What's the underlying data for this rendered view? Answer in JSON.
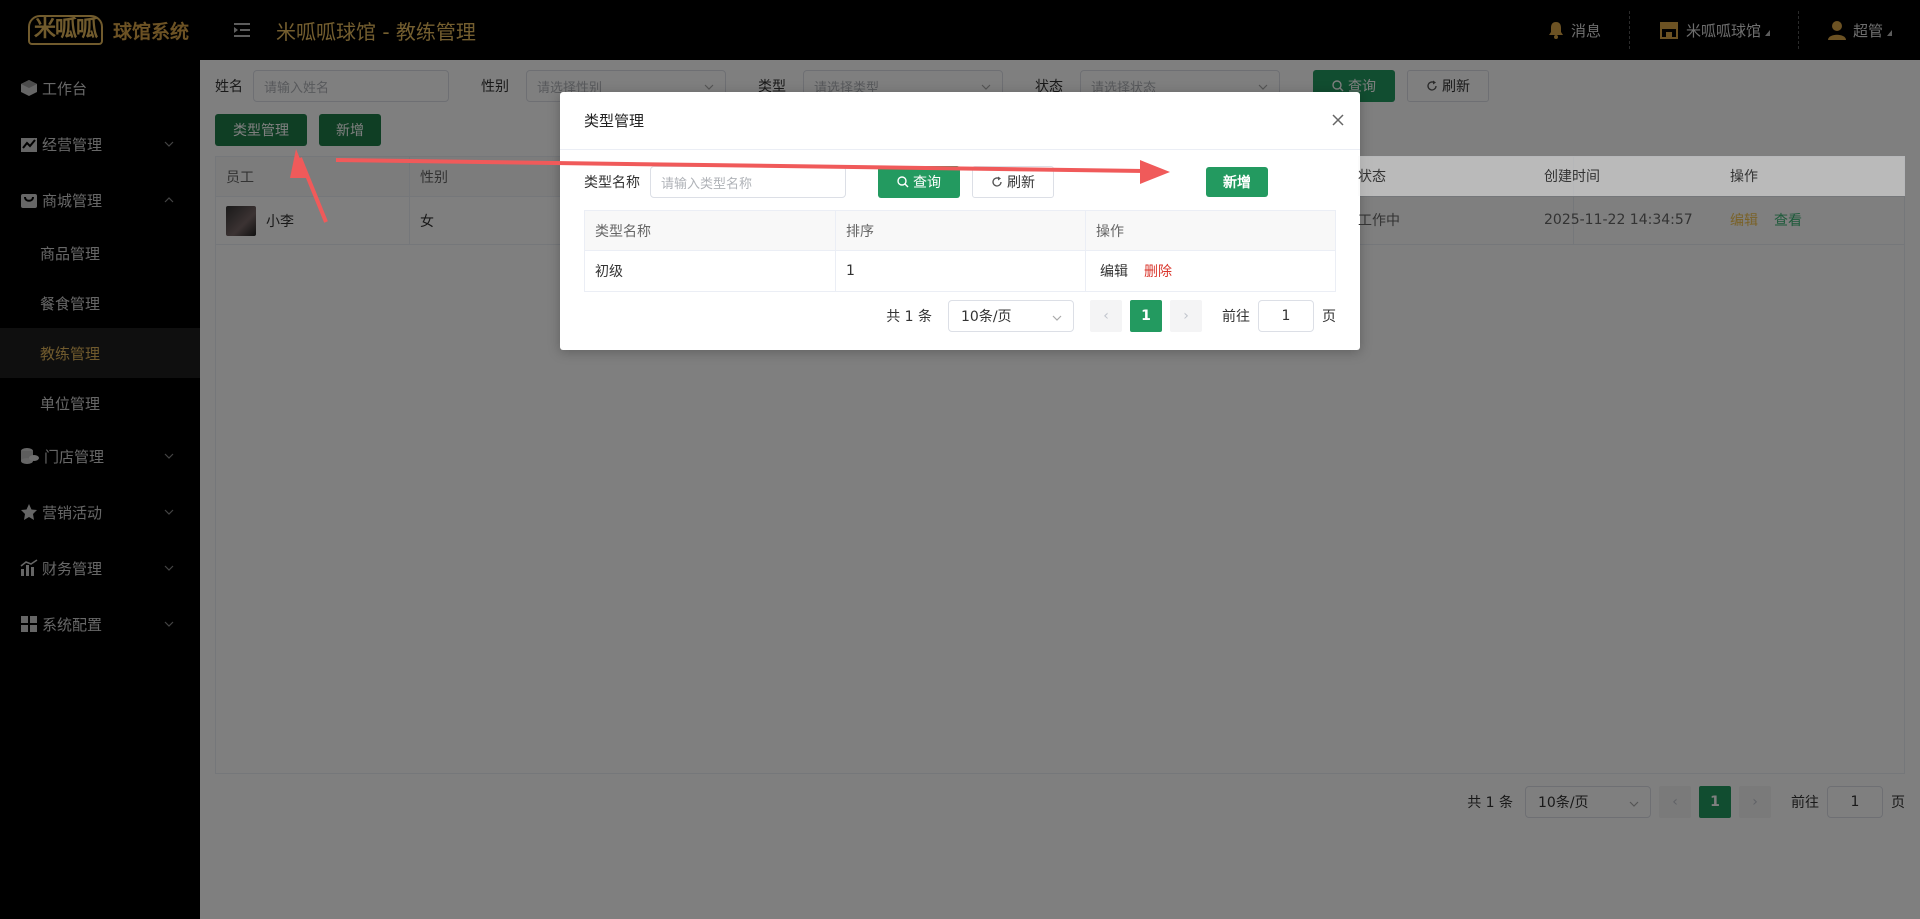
{
  "header": {
    "logo_mark": "米呱呱",
    "logo_text": "球馆系统",
    "title": "米呱呱球馆 - 教练管理",
    "messages_label": "消息",
    "store_label": "米呱呱球馆",
    "user_label": "超管"
  },
  "sidebar": {
    "items": [
      {
        "label": "工作台",
        "icon": "cube-icon"
      },
      {
        "label": "经营管理",
        "icon": "chart-icon"
      },
      {
        "label": "商城管理",
        "icon": "bag-icon"
      },
      {
        "label": "商品管理"
      },
      {
        "label": "餐食管理"
      },
      {
        "label": "教练管理"
      },
      {
        "label": "单位管理"
      },
      {
        "label": "门店管理",
        "icon": "coins-icon"
      },
      {
        "label": "营销活动",
        "icon": "star-icon"
      },
      {
        "label": "财务管理",
        "icon": "bars-icon"
      },
      {
        "label": "系统配置",
        "icon": "grid-icon"
      }
    ]
  },
  "filters": {
    "name_label": "姓名",
    "name_placeholder": "请输入姓名",
    "gender_label": "性别",
    "gender_placeholder": "请选择性别",
    "type_label": "类型",
    "type_placeholder": "请选择类型",
    "status_label": "状态",
    "status_placeholder": "请选择状态",
    "query_label": "查询",
    "refresh_label": "刷新"
  },
  "actions": {
    "type_manage_label": "类型管理",
    "add_label": "新增"
  },
  "table": {
    "columns": [
      "员工",
      "性别",
      "状态",
      "创建时间",
      "操作"
    ],
    "rows": [
      {
        "name": "小李",
        "gender": "女",
        "status": "工作中",
        "created": "2025-11-22 14:34:57",
        "edit": "编辑",
        "view": "查看"
      }
    ]
  },
  "pager": {
    "total": "共 1 条",
    "size": "10条/页",
    "page": "1",
    "goto_label": "前往",
    "goto_value": "1",
    "page_suffix": "页"
  },
  "dialog": {
    "title": "类型管理",
    "search_label": "类型名称",
    "search_placeholder": "请输入类型名称",
    "query_label": "查询",
    "refresh_label": "刷新",
    "add_label": "新增",
    "columns": [
      "类型名称",
      "排序",
      "操作"
    ],
    "rows": [
      {
        "name": "初级",
        "sort": "1",
        "edit": "编辑",
        "delete": "删除"
      }
    ],
    "pager": {
      "total": "共 1 条",
      "size": "10条/页",
      "page": "1",
      "goto_label": "前往",
      "goto_value": "1",
      "page_suffix": "页"
    }
  },
  "colors": {
    "accent_gold": "#e9bd5f",
    "primary_green": "#239a60",
    "danger_red": "#d9362c",
    "annotation_red": "#f05a5a"
  }
}
